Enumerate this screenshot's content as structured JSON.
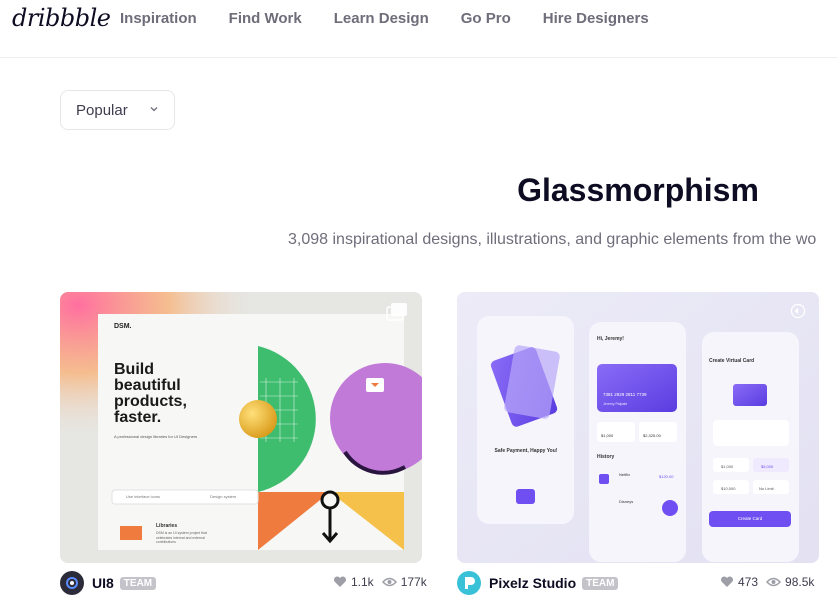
{
  "header": {
    "logo": "dribbble",
    "nav": [
      "Inspiration",
      "Find Work",
      "Learn Design",
      "Go Pro",
      "Hire Designers"
    ]
  },
  "filter": {
    "selected": "Popular"
  },
  "page": {
    "title": "Glassmorphism",
    "subtitle": "3,098 inspirational designs, illustrations, and graphic elements from the wo"
  },
  "shots": [
    {
      "author": "UI8",
      "badge": "TEAM",
      "likes": "1.1k",
      "views": "177k",
      "preview": {
        "brand": "DSM.",
        "headline": "Build beautiful products, faster.",
        "tagline": "A professional design libraries for UI Designers",
        "search": "Use interface icons",
        "dropdown": "Design system",
        "lib_title": "Libraries",
        "lib_text": "DSM is an UI system project that celebrates internal and external contributions",
        "accent_colors": [
          "#3ebd6f",
          "#c27ad8",
          "#f5c14b",
          "#ef7b3e"
        ]
      }
    },
    {
      "author": "Pixelz Studio",
      "badge": "TEAM",
      "likes": "473",
      "views": "98.5k",
      "preview": {
        "screen1_title": "Safe Payment, Happy You!",
        "greeting": "Hi, Jeremy!",
        "card_number": "7381 2929 2811 7739",
        "card_name": "Jeremy Palpate",
        "credit_limit": "$1,000",
        "monthly_spend": "$2,325.00",
        "history": "History",
        "tx1": "Netflix",
        "tx1_amount": "$120.00",
        "tx2": "Disneys",
        "screen3_title": "Create Virtual Card",
        "amounts": [
          "$1,000",
          "$5,000",
          "$10,000",
          "No Limit"
        ],
        "cta": "Create Card",
        "accent": "#6f4ff2"
      }
    }
  ]
}
